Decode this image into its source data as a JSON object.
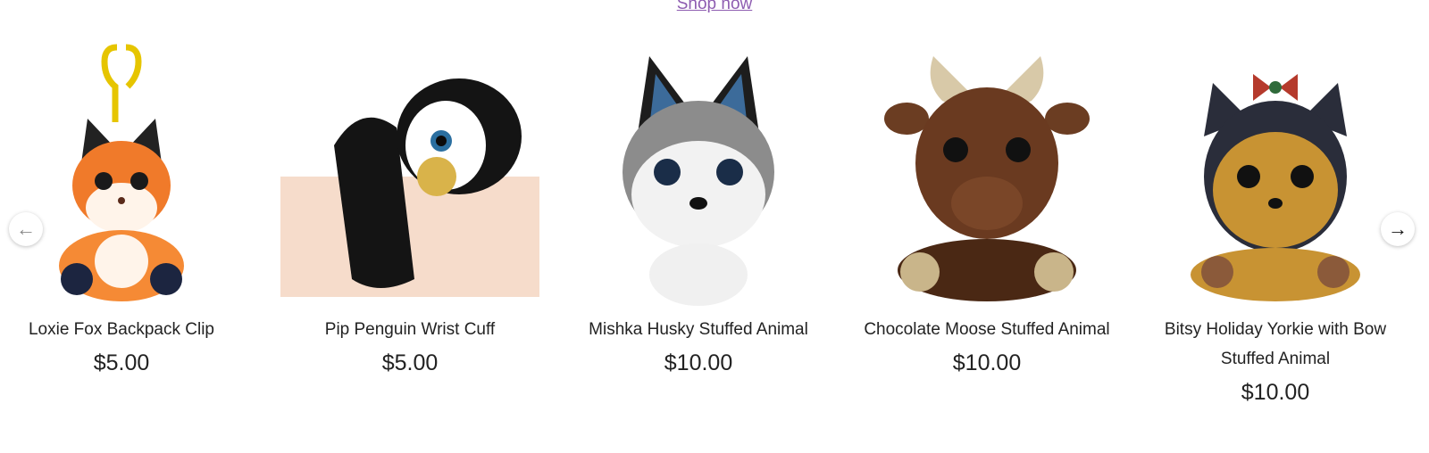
{
  "header": {
    "shop_link": "Shop now"
  },
  "carousel": {
    "prev_icon": "arrow-left-icon",
    "next_icon": "arrow-right-icon",
    "products": [
      {
        "title": "Loxie Fox Backpack Clip",
        "price": "$5.00",
        "image": "fox-plush-image"
      },
      {
        "title": "Pip Penguin Wrist Cuff",
        "price": "$5.00",
        "image": "penguin-plush-image"
      },
      {
        "title": "Mishka Husky Stuffed Animal",
        "price": "$10.00",
        "image": "husky-plush-image"
      },
      {
        "title": "Chocolate Moose Stuffed Animal",
        "price": "$10.00",
        "image": "moose-plush-image"
      },
      {
        "title": "Bitsy Holiday Yorkie with Bow Stuffed Animal",
        "price": "$10.00",
        "image": "yorkie-plush-image"
      }
    ]
  },
  "colors": {
    "link": "#8e5db1",
    "text": "#222222",
    "background": "#ffffff"
  }
}
